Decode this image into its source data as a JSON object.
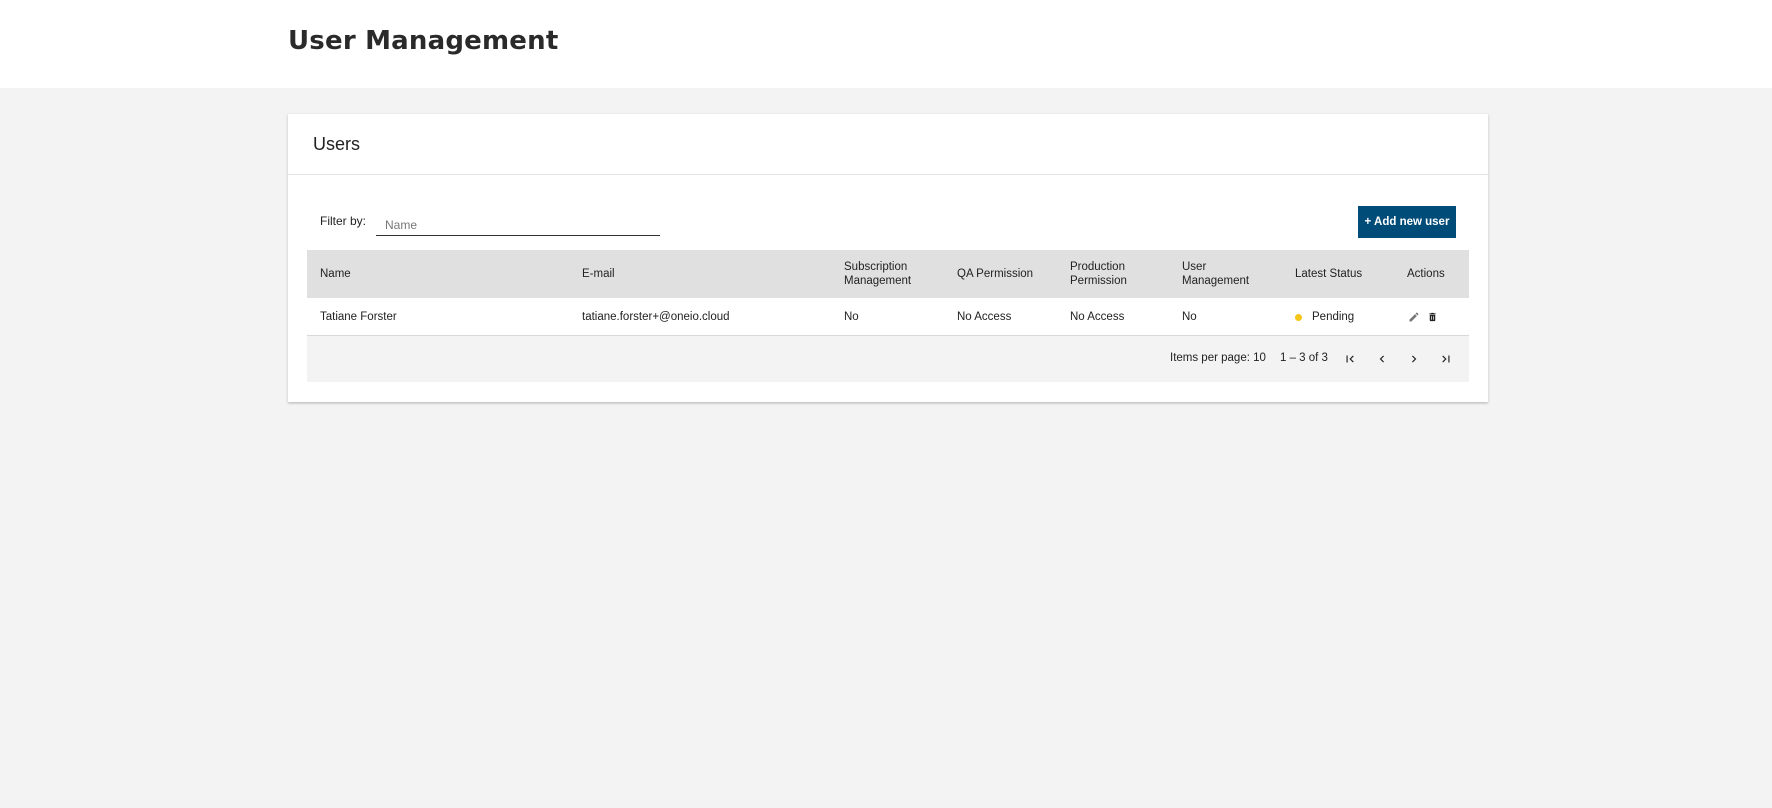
{
  "header": {
    "title": "User Management"
  },
  "card": {
    "title": "Users"
  },
  "filter": {
    "label": "Filter by:",
    "placeholder": "Name",
    "value": ""
  },
  "add_button": {
    "label": "+ Add new user"
  },
  "table": {
    "columns": [
      "Name",
      "E-mail",
      "Subscription\nManagement",
      "QA Permission",
      "Production\nPermission",
      "User\nManagement",
      "Latest Status",
      "Actions"
    ],
    "rows": [
      {
        "name": "Tatiane Forster",
        "email": "tatiane.forster+@oneio.cloud",
        "subscription_management": "No",
        "qa_permission": "No Access",
        "production_permission": "No Access",
        "user_management": "No",
        "latest_status": "Pending",
        "actions": [
          "edit-icon",
          "delete-icon"
        ]
      }
    ]
  },
  "paginator": {
    "items_per_page_label": "Items per page: 10",
    "range_label": "1 – 3 of 3",
    "buttons": [
      "first-page-icon",
      "previous-page-icon",
      "next-page-icon",
      "last-page-icon"
    ]
  },
  "colors": {
    "accent": "#004c78",
    "pending_status": "#f5c518",
    "header_row_bg": "#e0e0e0",
    "page_bg": "#f3f3f3"
  }
}
